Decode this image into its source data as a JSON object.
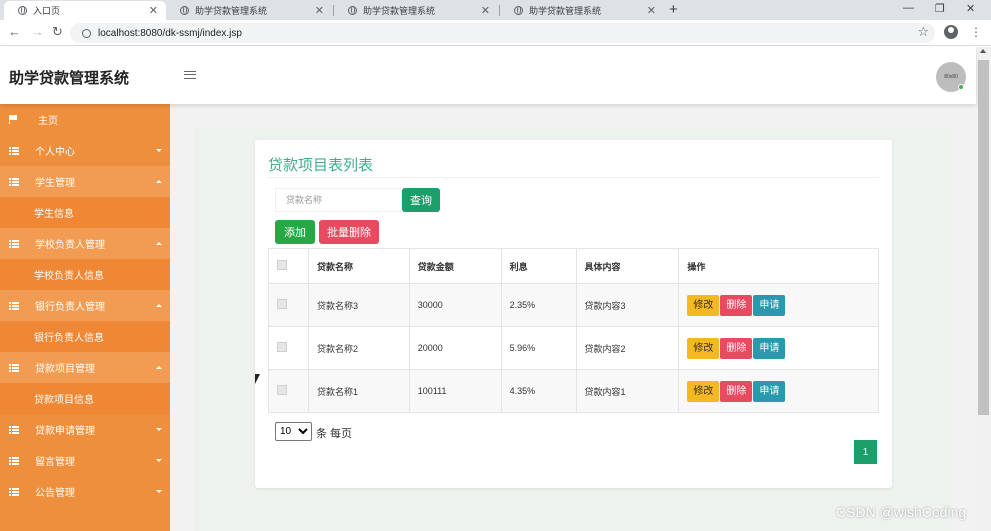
{
  "browser": {
    "tabs": [
      {
        "title": "入口页",
        "active": true
      },
      {
        "title": "助学贷款管理系统",
        "active": false
      },
      {
        "title": "助学贷款管理系统",
        "active": false
      },
      {
        "title": "助学贷款管理系统",
        "active": false
      }
    ],
    "new_tab": "+",
    "url": "localhost:8080/dk-ssmj/index.jsp",
    "window_controls": {
      "minimize": "—",
      "restore": "❐",
      "close": "✕"
    }
  },
  "header": {
    "app_title": "助学贷款管理系统",
    "avatar_text": "80x80"
  },
  "sidebar": {
    "home": "主页",
    "items": [
      {
        "label": "个人中心",
        "children": []
      },
      {
        "label": "学生管理",
        "children": [
          "学生信息"
        ]
      },
      {
        "label": "学校负责人管理",
        "children": [
          "学校负责人信息"
        ]
      },
      {
        "label": "银行负责人管理",
        "children": [
          "银行负责人信息"
        ]
      },
      {
        "label": "贷款项目管理",
        "children": [
          "贷款项目信息"
        ]
      },
      {
        "label": "贷款申请管理",
        "children": []
      },
      {
        "label": "留言管理",
        "children": []
      },
      {
        "label": "公告管理",
        "children": []
      }
    ]
  },
  "card": {
    "title": "贷款项目表列表",
    "search_placeholder": "贷款名称",
    "query_label": "查询",
    "add_label": "添加",
    "batch_delete_label": "批量删除"
  },
  "table": {
    "headers": [
      "贷款名称",
      "贷款金额",
      "利息",
      "具体内容",
      "操作"
    ],
    "rows": [
      {
        "name": "贷款名称3",
        "amount": "30000",
        "interest": "2.35%",
        "content": "贷款内容3"
      },
      {
        "name": "贷款名称2",
        "amount": "20000",
        "interest": "5.96%",
        "content": "贷款内容2"
      },
      {
        "name": "贷款名称1",
        "amount": "100111",
        "interest": "4.35%",
        "content": "贷款内容1"
      }
    ],
    "actions": {
      "edit": "修改",
      "delete": "删除",
      "apply": "申请"
    }
  },
  "pagination": {
    "page_size": "10",
    "page_size_options": [
      "10"
    ],
    "page_size_suffix": "条 每页",
    "current_page": "1"
  },
  "watermark": "CSDN @wishCoding",
  "colors": {
    "sidebar": "#ee8f3e",
    "accent_green": "#1d9f6c",
    "add_green": "#27a844",
    "danger": "#e84a5f",
    "warning": "#f5b820",
    "info": "#2a99ad",
    "title_green": "#3fae88"
  }
}
